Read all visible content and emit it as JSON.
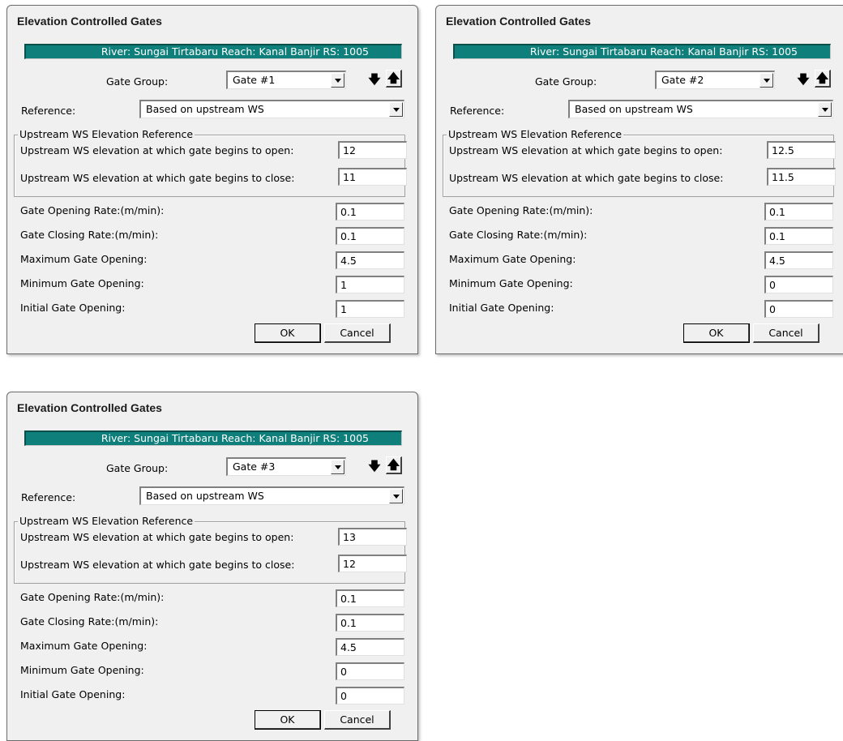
{
  "dialogs": [
    {
      "title": "Elevation Controlled Gates",
      "banner": "River: Sungai Tirtabaru  Reach: Kanal Banjir  RS: 1005",
      "gate_group_label": "Gate Group:",
      "gate_group_value": "Gate #1",
      "reference_label": "Reference:",
      "reference_value": "Based on upstream WS",
      "group_title": "Upstream WS Elevation Reference",
      "open_label": "Upstream WS elevation at which gate begins to open:",
      "open_value": "12",
      "close_label": "Upstream WS elevation at which gate begins to close:",
      "close_value": "11",
      "opening_rate_label": "Gate Opening Rate:(m/min):",
      "opening_rate_value": "0.1",
      "closing_rate_label": "Gate Closing Rate:(m/min):",
      "closing_rate_value": "0.1",
      "max_label": "Maximum Gate Opening:",
      "max_value": "4.5",
      "min_label": "Minimum Gate Opening:",
      "min_value": "1",
      "initial_label": "Initial Gate Opening:",
      "initial_value": "1",
      "ok_label": "OK",
      "cancel_label": "Cancel"
    },
    {
      "title": "Elevation Controlled Gates",
      "banner": "River: Sungai Tirtabaru  Reach: Kanal Banjir  RS: 1005",
      "gate_group_label": "Gate Group:",
      "gate_group_value": "Gate #2",
      "reference_label": "Reference:",
      "reference_value": "Based on upstream WS",
      "group_title": "Upstream WS Elevation Reference",
      "open_label": "Upstream WS elevation at which gate begins to open:",
      "open_value": "12.5",
      "close_label": "Upstream WS elevation at which gate begins to close:",
      "close_value": "11.5",
      "opening_rate_label": "Gate Opening Rate:(m/min):",
      "opening_rate_value": "0.1",
      "closing_rate_label": "Gate Closing Rate:(m/min):",
      "closing_rate_value": "0.1",
      "max_label": "Maximum Gate Opening:",
      "max_value": "4.5",
      "min_label": "Minimum Gate Opening:",
      "min_value": "0",
      "initial_label": "Initial Gate Opening:",
      "initial_value": "0",
      "ok_label": "OK",
      "cancel_label": "Cancel"
    },
    {
      "title": "Elevation Controlled Gates",
      "banner": "River: Sungai Tirtabaru  Reach: Kanal Banjir  RS: 1005",
      "gate_group_label": "Gate Group:",
      "gate_group_value": "Gate #3",
      "reference_label": "Reference:",
      "reference_value": "Based on upstream WS",
      "group_title": "Upstream WS Elevation Reference",
      "open_label": "Upstream WS elevation at which gate begins to open:",
      "open_value": "13",
      "close_label": "Upstream WS elevation at which gate begins to close:",
      "close_value": "12",
      "opening_rate_label": "Gate Opening Rate:(m/min):",
      "opening_rate_value": "0.1",
      "closing_rate_label": "Gate Closing Rate:(m/min):",
      "closing_rate_value": "0.1",
      "max_label": "Maximum Gate Opening:",
      "max_value": "4.5",
      "min_label": "Minimum Gate Opening:",
      "min_value": "0",
      "initial_label": "Initial Gate Opening:",
      "initial_value": "0",
      "ok_label": "OK",
      "cancel_label": "Cancel"
    }
  ],
  "icons": {
    "down_arrow": "arrow-down-icon",
    "up_arrow": "arrow-up-icon",
    "dropdown": "chevron-down-icon"
  }
}
